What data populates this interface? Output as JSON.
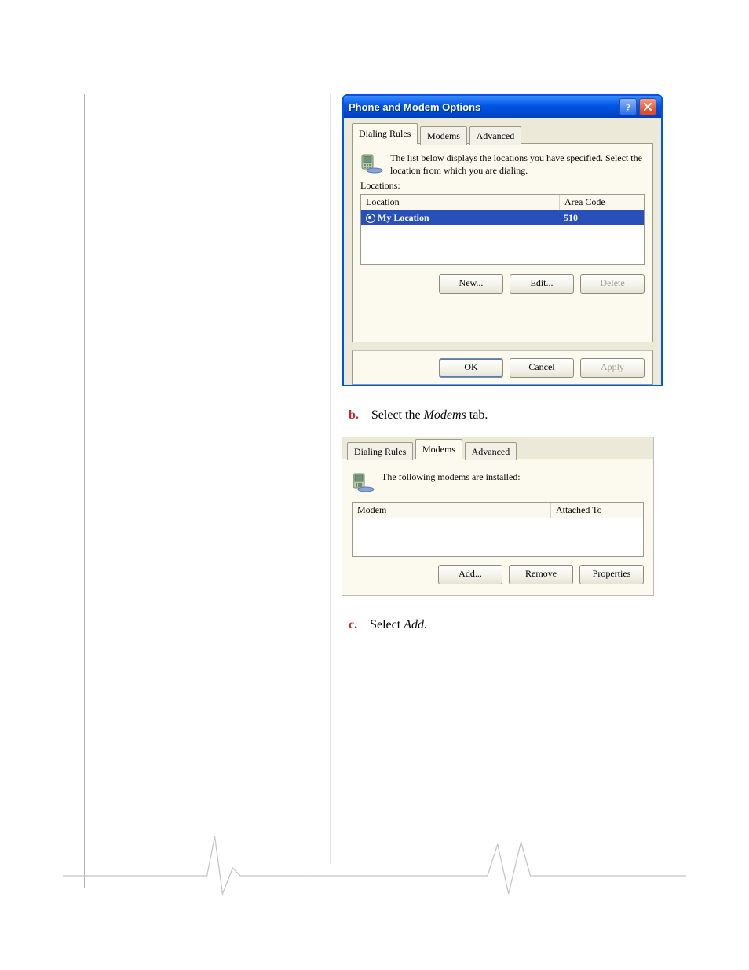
{
  "dialog1": {
    "title": "Phone and Modem Options",
    "buttons": {
      "help_tooltip": "Help",
      "close_tooltip": "Close"
    },
    "tabs": [
      "Dialing Rules",
      "Modems",
      "Advanced"
    ],
    "active_tab": "Dialing Rules",
    "description": "The list below displays the locations you have specified. Select the location from which you are dialing.",
    "locations_label": "Locations:",
    "columns": {
      "location": "Location",
      "area_code": "Area Code"
    },
    "rows": [
      {
        "location": "My Location",
        "area_code": "510",
        "selected": true
      }
    ],
    "row_buttons": {
      "new": "New...",
      "edit": "Edit...",
      "delete": "Delete"
    },
    "footer": {
      "ok": "OK",
      "cancel": "Cancel",
      "apply": "Apply"
    }
  },
  "steps": {
    "b": {
      "label": "b.",
      "pre": "Select the ",
      "em": "Modems",
      "post": " tab."
    },
    "c": {
      "label": "c.",
      "pre": "Select ",
      "em": "Add",
      "post": "."
    }
  },
  "dialog2": {
    "tabs": [
      "Dialing Rules",
      "Modems",
      "Advanced"
    ],
    "active_tab": "Modems",
    "description": "The following modems are  installed:",
    "columns": {
      "modem": "Modem",
      "attached": "Attached To"
    },
    "row_buttons": {
      "add": "Add...",
      "remove": "Remove",
      "properties": "Properties"
    }
  }
}
